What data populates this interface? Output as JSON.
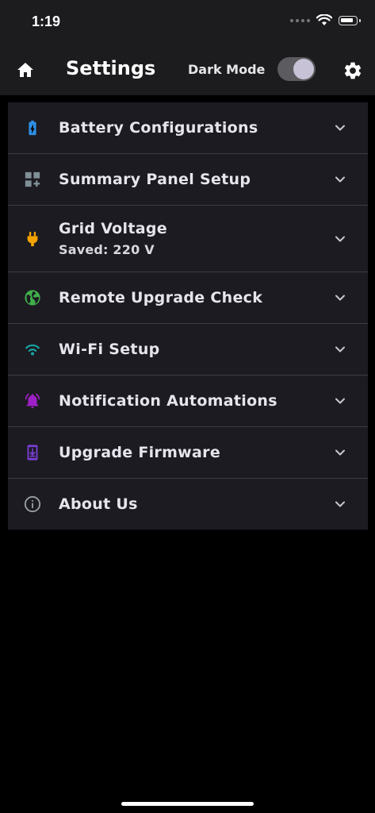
{
  "status_bar": {
    "time": "1:19"
  },
  "header": {
    "title": "Settings",
    "dark_mode_label": "Dark Mode",
    "dark_mode_on": true
  },
  "settings_items": [
    {
      "label": "Battery Configurations",
      "icon": "battery-charging-icon",
      "icon_color": "#2e8fe6"
    },
    {
      "label": "Summary Panel Setup",
      "icon": "dashboard-add-icon",
      "icon_color": "#7f9096"
    },
    {
      "label": "Grid Voltage",
      "sublabel": "Saved: 220 V",
      "icon": "power-plug-icon",
      "icon_color": "#f5a300"
    },
    {
      "label": "Remote Upgrade Check",
      "icon": "globe-icon",
      "icon_color": "#3fae4a"
    },
    {
      "label": "Wi-Fi Setup",
      "icon": "wifi-icon",
      "icon_color": "#17a5a5"
    },
    {
      "label": "Notification Automations",
      "icon": "alarm-bell-icon",
      "icon_color": "#a020c8"
    },
    {
      "label": "Upgrade Firmware",
      "icon": "phone-download-icon",
      "icon_color": "#7b3fd8"
    },
    {
      "label": "About Us",
      "icon": "info-icon",
      "icon_color": "#9aa0a6"
    }
  ]
}
